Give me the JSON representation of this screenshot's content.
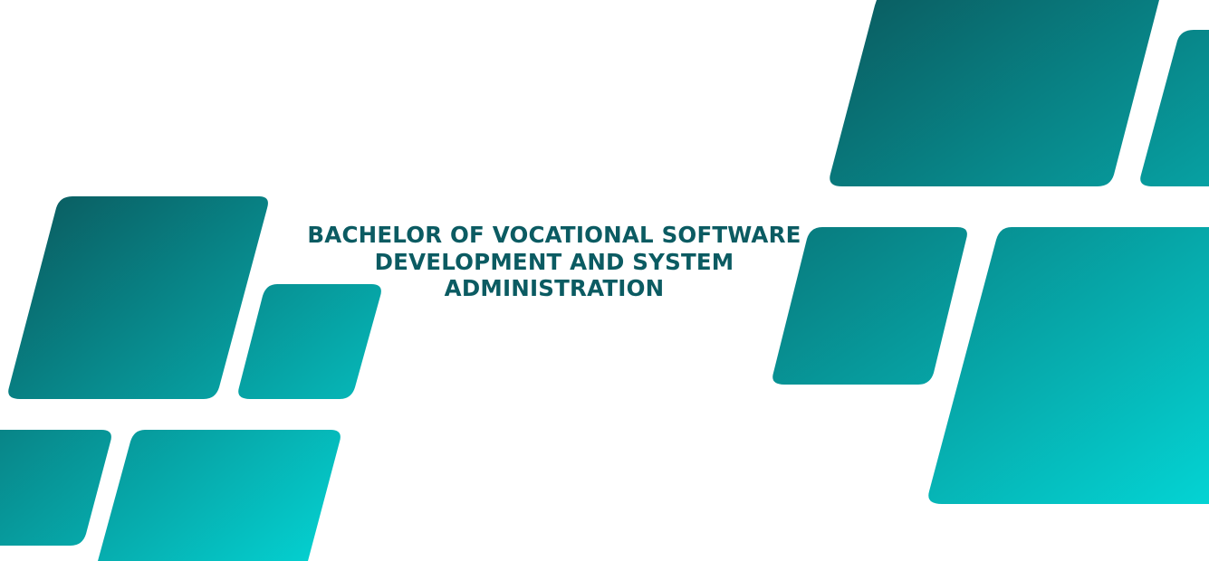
{
  "banner": {
    "title_lines": [
      "BACHELOR OF VOCATIONAL SOFTWARE",
      "DEVELOPMENT AND SYSTEM",
      "ADMINISTRATION"
    ]
  },
  "colors": {
    "background": "#ffffff",
    "title_text": "#0b5b62",
    "gradient_dark": "#0a5f63",
    "gradient_light": "#04d4d4"
  }
}
